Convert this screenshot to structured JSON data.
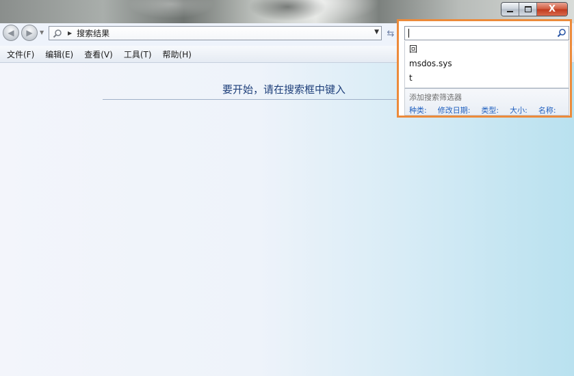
{
  "window": {
    "controls": {
      "close_label": "X"
    }
  },
  "address": {
    "location": "搜索结果"
  },
  "menu": {
    "items": [
      {
        "label": "文件(F)"
      },
      {
        "label": "编辑(E)"
      },
      {
        "label": "查看(V)"
      },
      {
        "label": "工具(T)"
      },
      {
        "label": "帮助(H)"
      }
    ]
  },
  "content": {
    "empty_message": "要开始，请在搜索框中键入"
  },
  "search": {
    "value": "",
    "suggestions": [
      {
        "label": "回"
      },
      {
        "label": "msdos.sys"
      },
      {
        "label": "t"
      }
    ],
    "filters_label": "添加搜索筛选器",
    "filters": [
      {
        "label": "种类:"
      },
      {
        "label": "修改日期:"
      },
      {
        "label": "类型:"
      },
      {
        "label": "大小:"
      },
      {
        "label": "名称:"
      }
    ]
  },
  "colors": {
    "highlight_border": "#ec8a3a",
    "link": "#1f5fbf",
    "heading": "#1e3f7a"
  }
}
